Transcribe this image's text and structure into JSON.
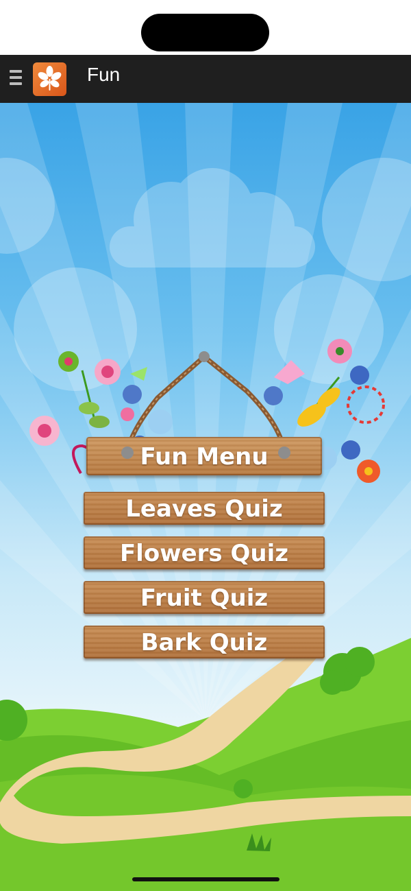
{
  "header": {
    "title": "Fun",
    "menu_icon": "hamburger-menu-icon",
    "app_icon": "leaf-logo-icon"
  },
  "sign": {
    "title": "Fun Menu"
  },
  "menu": {
    "items": [
      {
        "label": "Leaves Quiz"
      },
      {
        "label": "Flowers Quiz"
      },
      {
        "label": "Fruit Quiz"
      },
      {
        "label": "Bark Quiz"
      }
    ]
  },
  "colors": {
    "navbar": "#1f1f1f",
    "app_icon": "#e06a25",
    "sky": "#39a3e6",
    "grass": "#6cc42a",
    "wood": "#c08449"
  }
}
